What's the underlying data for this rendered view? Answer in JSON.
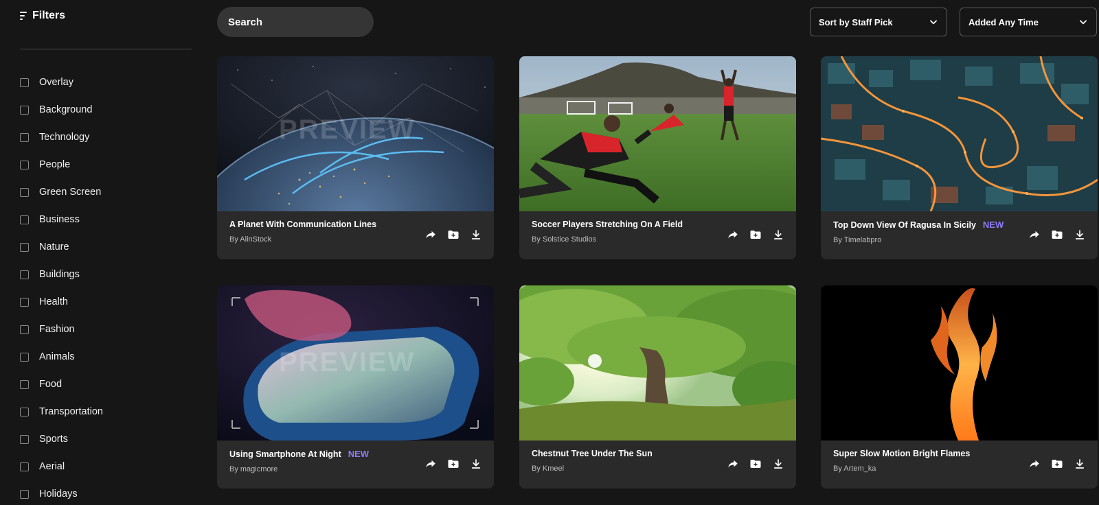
{
  "sidebar": {
    "title": "Filters",
    "items": [
      {
        "label": "Overlay"
      },
      {
        "label": "Background"
      },
      {
        "label": "Technology"
      },
      {
        "label": "People"
      },
      {
        "label": "Green Screen"
      },
      {
        "label": "Business"
      },
      {
        "label": "Nature"
      },
      {
        "label": "Buildings"
      },
      {
        "label": "Health"
      },
      {
        "label": "Fashion"
      },
      {
        "label": "Animals"
      },
      {
        "label": "Food"
      },
      {
        "label": "Transportation"
      },
      {
        "label": "Sports"
      },
      {
        "label": "Aerial"
      },
      {
        "label": "Holidays"
      }
    ]
  },
  "toolbar": {
    "search_placeholder": "Search",
    "sort_label": "Sort by Staff Pick",
    "time_label": "Added Any Time"
  },
  "watermark": "PREVIEW",
  "cards": [
    {
      "title": "A Planet With Communication Lines",
      "author": "By AlinStock",
      "badge": ""
    },
    {
      "title": "Soccer Players Stretching On A Field",
      "author": "By Solstice Studios",
      "badge": ""
    },
    {
      "title": "Top Down View Of Ragusa In Sicily",
      "author": "By Timelabpro",
      "badge": "NEW"
    },
    {
      "title": "Using Smartphone At Night",
      "author": "By magicmore",
      "badge": "NEW"
    },
    {
      "title": "Chestnut Tree Under The Sun",
      "author": "By Kmeel",
      "badge": ""
    },
    {
      "title": "Super Slow Motion Bright Flames",
      "author": "By Artem_ka",
      "badge": ""
    }
  ],
  "colors": {
    "background": "#161616",
    "card": "#2a2a2a",
    "search_bg": "#353535",
    "new_badge": "#8b7cf6"
  },
  "icons": {
    "filters": "filters-icon",
    "search": "search-icon",
    "dropdown": "chevron-down-icon",
    "share": "share-icon",
    "add_to_folder": "folder-plus-icon",
    "download": "download-icon"
  }
}
